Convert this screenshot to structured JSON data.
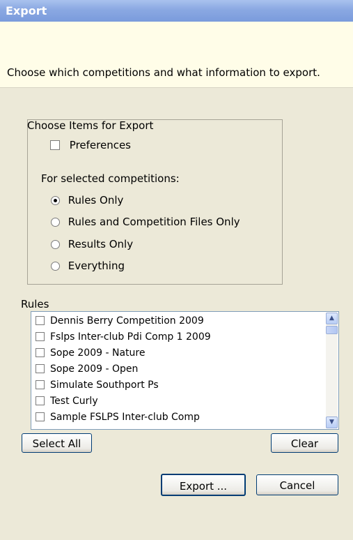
{
  "window": {
    "title": "Export"
  },
  "header": {
    "instruction": "Choose which competitions and what information to export."
  },
  "options_group": {
    "legend": "Choose Items for Export",
    "preferences_label": "Preferences",
    "selected_label": "For selected competitions:",
    "radios": [
      {
        "label": "Rules Only",
        "selected": true
      },
      {
        "label": "Rules and Competition Files Only",
        "selected": false
      },
      {
        "label": "Results Only",
        "selected": false
      },
      {
        "label": "Everything",
        "selected": false
      }
    ]
  },
  "rules": {
    "label": "Rules",
    "items": [
      {
        "label": "Dennis Berry Competition 2009",
        "checked": false
      },
      {
        "label": "Fslps Inter-club Pdi Comp 1 2009",
        "checked": false
      },
      {
        "label": "Sope 2009 - Nature",
        "checked": false
      },
      {
        "label": "Sope 2009 - Open",
        "checked": false
      },
      {
        "label": "Simulate Southport Ps",
        "checked": false
      },
      {
        "label": "Test Curly",
        "checked": false
      },
      {
        "label": "Sample FSLPS Inter-club Comp",
        "checked": false
      }
    ]
  },
  "buttons": {
    "select_all": "Select All",
    "clear": "Clear",
    "export": "Export ...",
    "cancel": "Cancel"
  }
}
